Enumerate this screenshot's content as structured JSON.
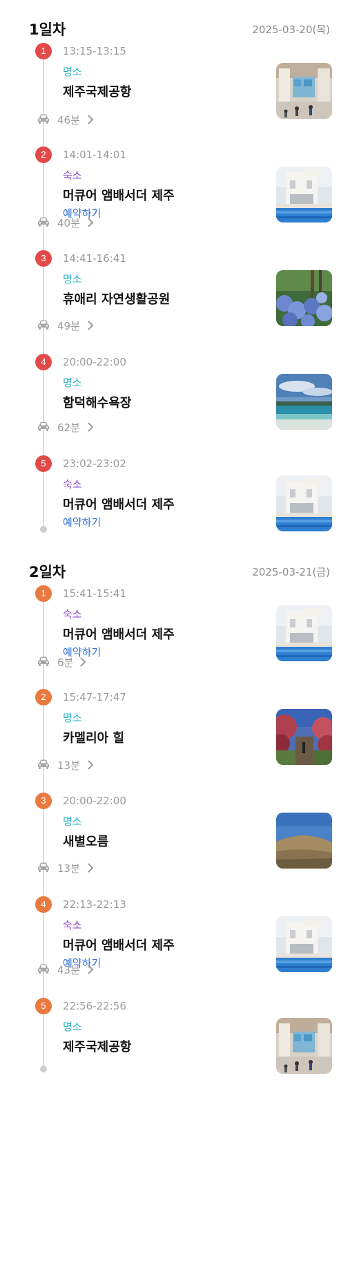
{
  "colors": {
    "day1_badge": "#e24a4a",
    "day2_badge": "#e8793f",
    "category_attraction": "#2ab3c8",
    "category_lodging": "#8a3fcf",
    "reserve": "#2f6fd6"
  },
  "days": [
    {
      "title": "1일차",
      "date": "2025-03-20(목)",
      "stops": [
        {
          "num": "1",
          "time": "13:15-13:15",
          "category": "명소",
          "name": "제주국제공항",
          "reserve": "",
          "image": "airport"
        },
        {
          "num": "2",
          "time": "14:01-14:01",
          "category": "숙소",
          "name": "머큐어 앰배서더 제주",
          "reserve": "예약하기",
          "image": "hotel"
        },
        {
          "num": "3",
          "time": "14:41-16:41",
          "category": "명소",
          "name": "휴애리 자연생활공원",
          "reserve": "",
          "image": "hydrangea"
        },
        {
          "num": "4",
          "time": "20:00-22:00",
          "category": "명소",
          "name": "함덕해수욕장",
          "reserve": "",
          "image": "beach"
        },
        {
          "num": "5",
          "time": "23:02-23:02",
          "category": "숙소",
          "name": "머큐어 앰배서더 제주",
          "reserve": "예약하기",
          "image": "hotel"
        }
      ],
      "travels": [
        "46분",
        "40분",
        "49분",
        "62분"
      ]
    },
    {
      "title": "2일차",
      "date": "2025-03-21(금)",
      "stops": [
        {
          "num": "1",
          "time": "15:41-15:41",
          "category": "숙소",
          "name": "머큐어 앰배서더 제주",
          "reserve": "예약하기",
          "image": "hotel"
        },
        {
          "num": "2",
          "time": "15:47-17:47",
          "category": "명소",
          "name": "카멜리아 힐",
          "reserve": "",
          "image": "camellia"
        },
        {
          "num": "3",
          "time": "20:00-22:00",
          "category": "명소",
          "name": "새별오름",
          "reserve": "",
          "image": "oreum"
        },
        {
          "num": "4",
          "time": "22:13-22:13",
          "category": "숙소",
          "name": "머큐어 앰배서더 제주",
          "reserve": "예약하기",
          "image": "hotel"
        },
        {
          "num": "5",
          "time": "22:56-22:56",
          "category": "명소",
          "name": "제주국제공항",
          "reserve": "",
          "image": "airport"
        }
      ],
      "travels": [
        "6분",
        "13분",
        "13분",
        "43분"
      ]
    }
  ]
}
